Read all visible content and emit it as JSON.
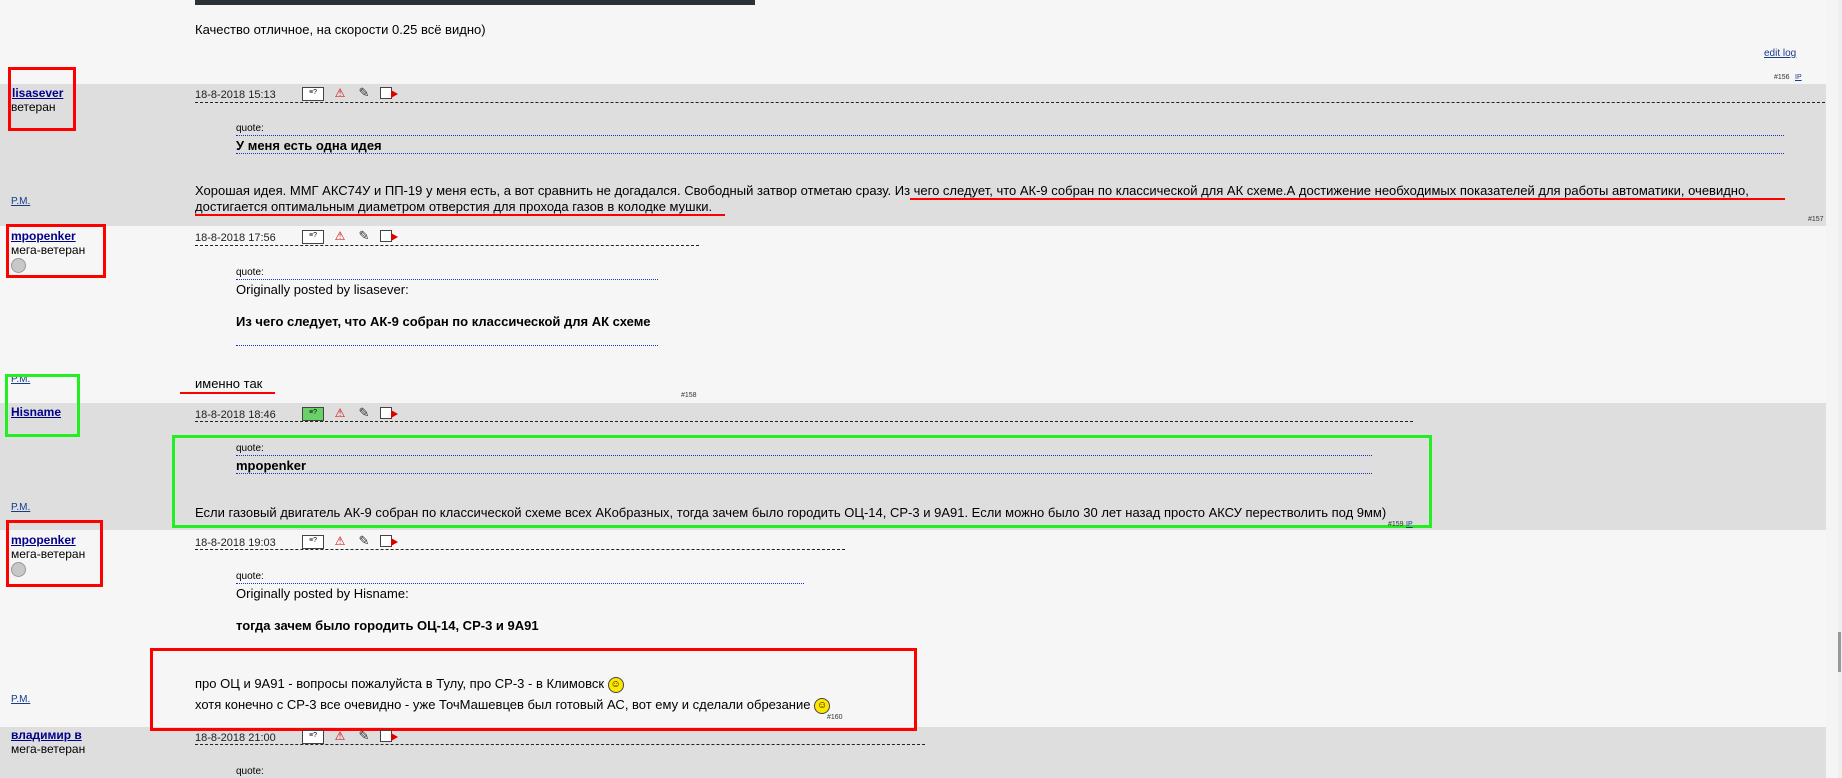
{
  "top": {
    "message": "Качество отличное, на скорости 0.25 всё видно)",
    "edit_log": "edit log",
    "post_num": "#156",
    "ip": "IP"
  },
  "icons": [
    "profile-icon",
    "warn-icon",
    "edit-icon",
    "reply-icon"
  ],
  "posts": [
    {
      "user": "lisasever",
      "rank": "ветеран",
      "pm": "P.M.",
      "date": "18-8-2018 15:13",
      "quote_label": "quote:",
      "quote_text": "У меня есть одна идея",
      "message_a": "Хорошая идея. ММГ АКС74У и ПП-19 у меня есть, а вот сравнить не догадался. Свободный затвор отметаю сразу. ",
      "message_b": "Из чего следует, что АК-9 собран по классической для АК схеме.А достижение необходимых показателей для работы автоматики, очевидно,",
      "message_c": "достигается оптимальным диаметром отверстия для прохода газов в колодке мушки.",
      "post_num": "#157"
    },
    {
      "user": "mpopenker",
      "rank": "мега-ветеран",
      "pm": "P.M.",
      "date": "18-8-2018 17:56",
      "quote_label": "quote:",
      "quote_orig": "Originally posted by lisasever:",
      "quote_text": "Из чего следует, что АК-9 собран по классической для АК схеме",
      "message": "именно так",
      "post_num": "#158"
    },
    {
      "user": "Hisname",
      "pm": "P.M.",
      "date": "18-8-2018 18:46",
      "quote_label": "quote:",
      "quote_text": "mpopenker",
      "message": "Если газовый двигатель АК-9 собран по классической схеме всех АКобразных, тогда зачем было городить ОЦ-14, СР-3 и 9А91. Если можно было 30 лет назад просто АКСУ перестволить под 9мм)",
      "post_num": "#159",
      "ip": "IP"
    },
    {
      "user": "mpopenker",
      "rank": "мега-ветеран",
      "pm": "P.M.",
      "date": "18-8-2018 19:03",
      "quote_label": "quote:",
      "quote_orig": "Originally posted by Hisname:",
      "quote_text": "тогда зачем было городить ОЦ-14, СР-3 и 9А91",
      "message_line1": "про ОЦ и 9А91 - вопросы пожалуйста в Тулу, про СР-3 - в Климовск",
      "message_line2": "хотя конечно с СР-3 все очевидно - уже ТочМашевцев был готовый АС, вот ему и сделали обрезание",
      "post_num": "#160"
    },
    {
      "user": "владимир в",
      "rank": "мега-ветеран",
      "date": "18-8-2018 21:00",
      "quote_label": "quote:"
    }
  ]
}
